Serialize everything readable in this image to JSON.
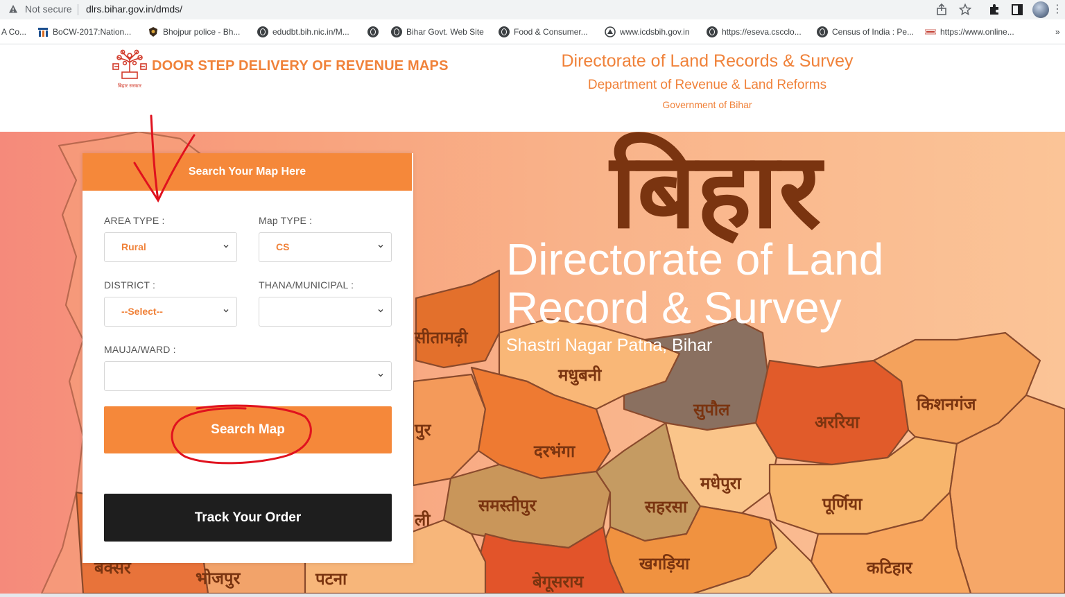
{
  "browser": {
    "security_label": "Not secure",
    "url": "dlrs.bihar.gov.in/dmds/"
  },
  "bookmarks": [
    {
      "label": "A Co..."
    },
    {
      "label": "BoCW-2017:Nation..."
    },
    {
      "label": "Bhojpur police - Bh..."
    },
    {
      "label": "edudbt.bih.nic.in/M..."
    },
    {
      "label": ""
    },
    {
      "label": "Bihar Govt. Web Site"
    },
    {
      "label": "Food & Consumer..."
    },
    {
      "label": "www.icdsbih.gov.in"
    },
    {
      "label": "https://eseva.cscclo..."
    },
    {
      "label": "Census of India : Pe..."
    },
    {
      "label": "https://www.online..."
    }
  ],
  "header": {
    "emblem_caption": "बिहार सरकार",
    "site_title": "DOOR STEP DELIVERY OF REVENUE MAPS",
    "dept_line1": "Directorate of Land Records & Survey",
    "dept_line2": "Department of Revenue & Land Reforms",
    "dept_line3": "Government of Bihar"
  },
  "hero": {
    "state_name": "बिहार",
    "title_line1": "Directorate of Land",
    "title_line2": "Record & Survey",
    "subtitle": "Shastri Nagar Patna, Bihar",
    "districts": [
      "सीतामढ़ी",
      "मधुबनी",
      "सुपौल",
      "अररिया",
      "किशनगंज",
      "दरभंगा",
      "मधेपुरा",
      "समस्तीपुर",
      "सहरसा",
      "पूर्णिया",
      "खगड़िया",
      "कटिहार",
      "बेगूसराय",
      "भोजपुर",
      "पटना",
      "बक्सर",
      "पुर",
      "ली"
    ]
  },
  "search_panel": {
    "title": "Search Your Map Here",
    "area_type_label": "AREA TYPE :",
    "area_type_value": "Rural",
    "map_type_label": "Map TYPE :",
    "map_type_value": "CS",
    "district_label": "DISTRICT :",
    "district_value": "--Select--",
    "thana_label": "THANA/MUNICIPAL :",
    "thana_value": "",
    "mauja_label": "MAUJA/WARD :",
    "mauja_value": "",
    "search_button": "Search Map",
    "track_button": "Track Your Order"
  },
  "colors": {
    "accent": "#f5883a",
    "dark_button": "#1e1e1e",
    "annotation_ink": "#e0121e",
    "district_text": "#7a3410"
  }
}
